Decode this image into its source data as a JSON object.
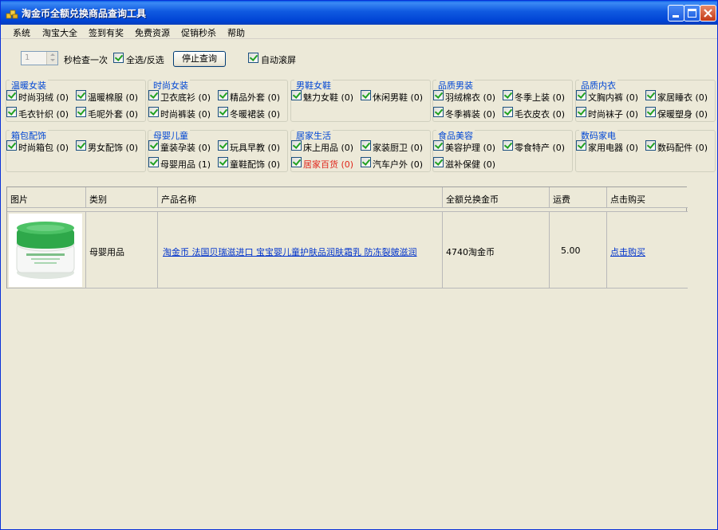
{
  "window": {
    "title": "淘金币全额兑换商品查询工具"
  },
  "menu": [
    "系统",
    "淘宝大全",
    "签到有奖",
    "免费资源",
    "促销秒杀",
    "帮助"
  ],
  "toolbar": {
    "interval_value": "1",
    "interval_suffix": "秒检查一次",
    "select_all_label": "全选/反选",
    "stop_button": "停止查询",
    "auto_scroll_label": "自动滚屏"
  },
  "groups": [
    {
      "title": "温暖女装",
      "items": [
        "时尚羽绒 (0)",
        "温暖棉服 (0)",
        "毛衣针织 (0)",
        "毛呢外套 (0)"
      ]
    },
    {
      "title": "时尚女装",
      "items": [
        "卫衣底衫 (0)",
        "精品外套 (0)",
        "时尚裤装 (0)",
        "冬暖裙装 (0)"
      ]
    },
    {
      "title": "男鞋女鞋",
      "items": [
        "魅力女鞋 (0)",
        "休闲男鞋 (0)"
      ]
    },
    {
      "title": "品质男装",
      "items": [
        "羽绒棉衣 (0)",
        "冬季上装 (0)",
        "冬季裤装 (0)",
        "毛衣皮衣 (0)"
      ]
    },
    {
      "title": "品质内衣",
      "items": [
        "文胸内裤 (0)",
        "家居睡衣 (0)",
        "时尚袜子 (0)",
        "保暖塑身 (0)"
      ]
    },
    {
      "title": "箱包配饰",
      "items": [
        "时尚箱包 (0)",
        "男女配饰 (0)"
      ]
    },
    {
      "title": "母婴儿童",
      "items": [
        "童装孕装 (0)",
        "玩具早教 (0)",
        "母婴用品 (1)",
        "童鞋配饰 (0)"
      ]
    },
    {
      "title": "居家生活",
      "items": [
        "床上用品 (0)",
        "家装厨卫 (0)",
        "居家百货 (0)",
        "汽车户外 (0)"
      ]
    },
    {
      "title": "食品美容",
      "items": [
        "美容护理 (0)",
        "零食特产 (0)",
        "滋补保健 (0)"
      ]
    },
    {
      "title": "数码家电",
      "items": [
        "家用电器 (0)",
        "数码配件 (0)"
      ]
    }
  ],
  "grid": {
    "columns": [
      "图片",
      "类别",
      "产品名称",
      "全额兑换金币",
      "运费",
      "点击购买"
    ],
    "rows": [
      {
        "category": "母婴用品",
        "name": "淘金币 法国贝瑞滋进口 宝宝婴儿童护肤品润肤霜乳 防冻裂皴滋润",
        "coins": "4740淘金币",
        "shipping": "5.00",
        "buy": "点击购买"
      }
    ]
  },
  "colors": {
    "title_bar": "#0054e3",
    "group_title": "#0046d5",
    "highlight_red": "#e0241a",
    "link": "#0033cc"
  }
}
